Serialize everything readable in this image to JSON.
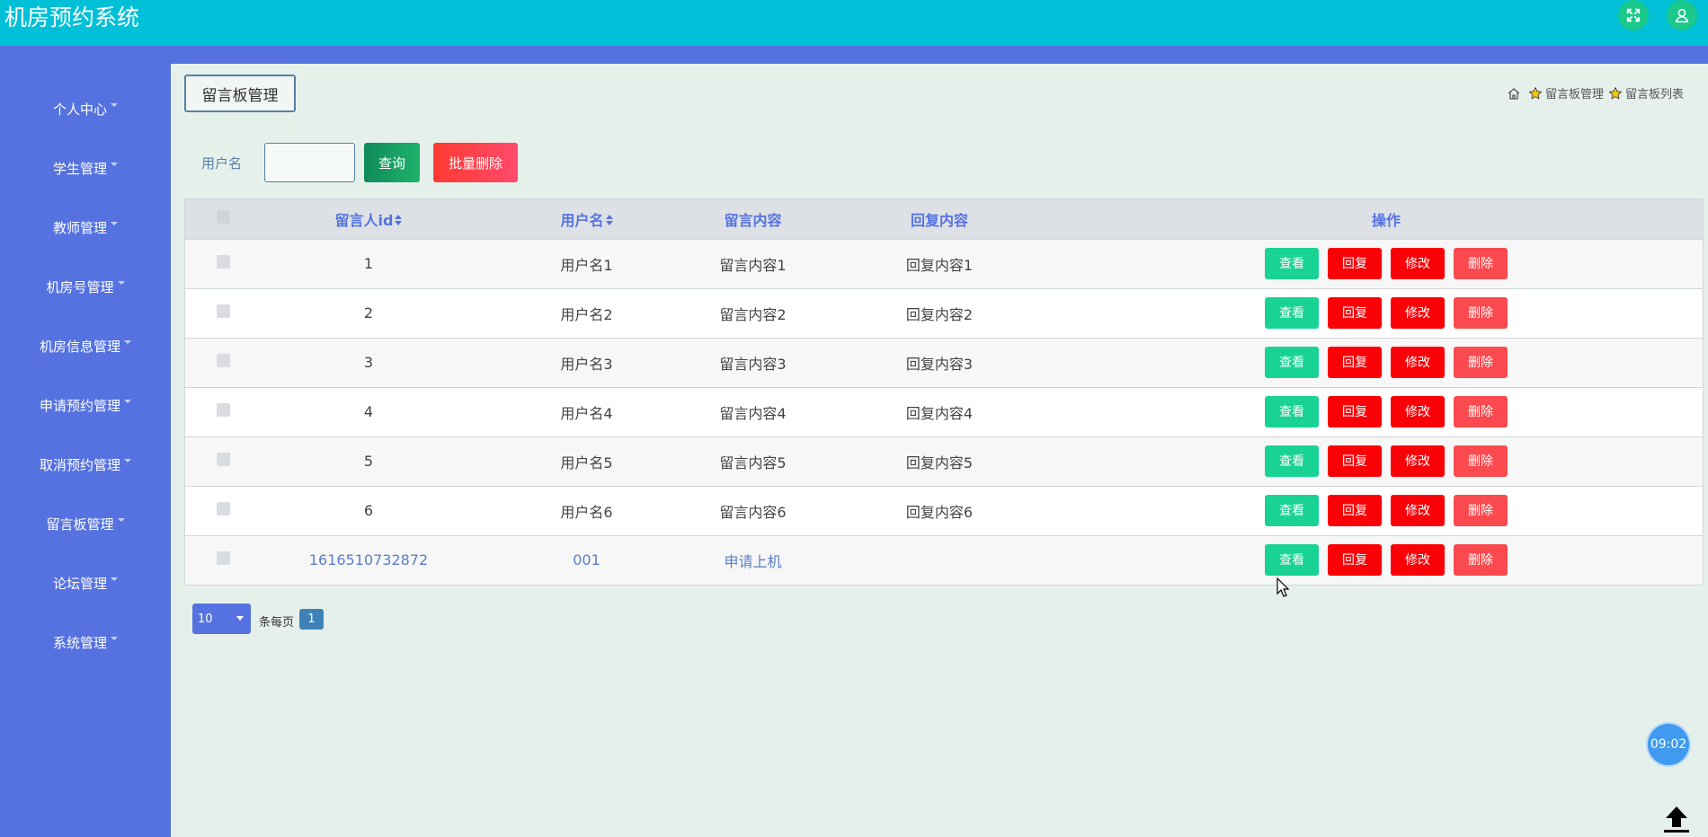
{
  "app": {
    "title": "机房预约系统"
  },
  "sidebar": {
    "items": [
      {
        "label": "个人中心"
      },
      {
        "label": "学生管理"
      },
      {
        "label": "教师管理"
      },
      {
        "label": "机房号管理"
      },
      {
        "label": "机房信息管理"
      },
      {
        "label": "申请预约管理"
      },
      {
        "label": "取消预约管理"
      },
      {
        "label": "留言板管理"
      },
      {
        "label": "论坛管理"
      },
      {
        "label": "系统管理"
      }
    ]
  },
  "page": {
    "title": "留言板管理",
    "breadcrumb": [
      "留言板管理",
      "留言板列表"
    ]
  },
  "search": {
    "label": "用户名",
    "value": "",
    "query_button": "查询",
    "batch_delete_button": "批量删除"
  },
  "table": {
    "headers": [
      "留言人id",
      "用户名",
      "留言内容",
      "回复内容",
      "操作"
    ],
    "rows": [
      {
        "id": "1",
        "username": "用户名1",
        "content": "留言内容1",
        "reply": "回复内容1"
      },
      {
        "id": "2",
        "username": "用户名2",
        "content": "留言内容2",
        "reply": "回复内容2"
      },
      {
        "id": "3",
        "username": "用户名3",
        "content": "留言内容3",
        "reply": "回复内容3"
      },
      {
        "id": "4",
        "username": "用户名4",
        "content": "留言内容4",
        "reply": "回复内容4"
      },
      {
        "id": "5",
        "username": "用户名5",
        "content": "留言内容5",
        "reply": "回复内容5"
      },
      {
        "id": "6",
        "username": "用户名6",
        "content": "留言内容6",
        "reply": "回复内容6"
      },
      {
        "id": "1616510732872",
        "username": "001",
        "content": "申请上机",
        "reply": ""
      }
    ],
    "actions": {
      "view": "查看",
      "reply": "回复",
      "edit": "修改",
      "delete": "删除"
    }
  },
  "pagination": {
    "page_size": "10",
    "per_page_label": "条每页",
    "current_page": "1"
  },
  "clock": {
    "time": "09:02"
  },
  "colors": {
    "topbar": "#00c0d7",
    "sidebar": "#5572e0",
    "view": "#19d394",
    "danger": "#fa0007"
  }
}
